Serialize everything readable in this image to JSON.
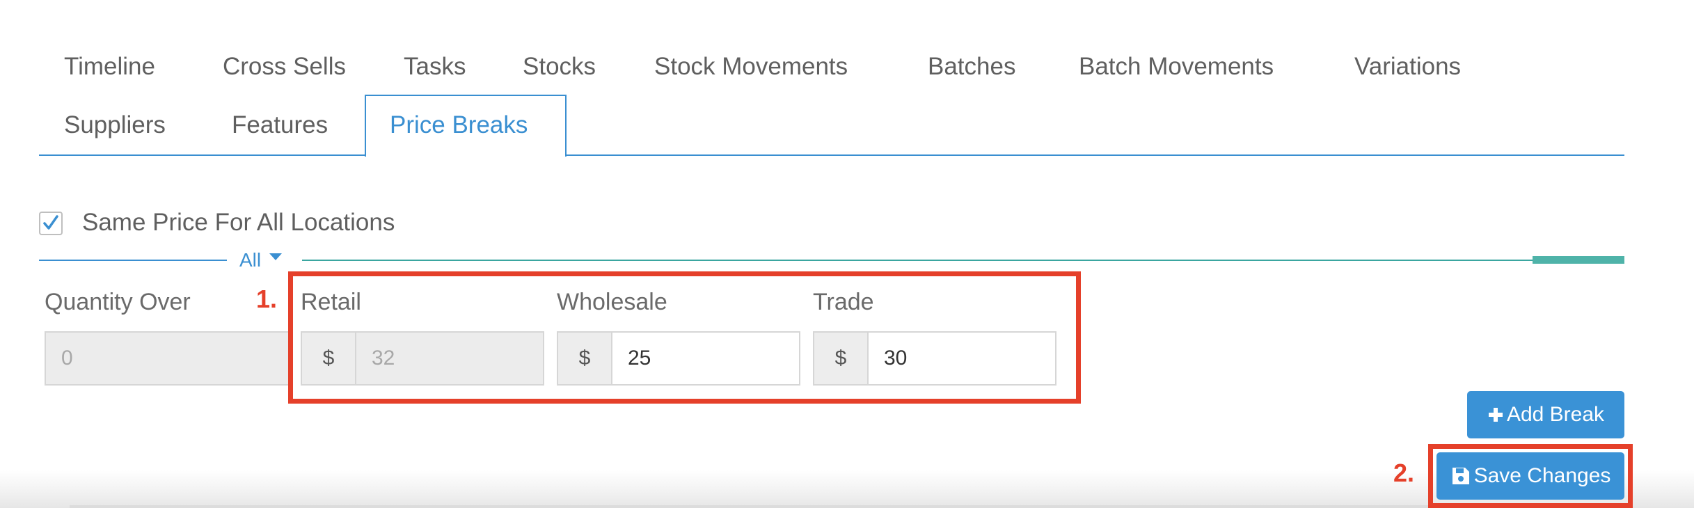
{
  "tabs": {
    "items": [
      {
        "label": "Timeline"
      },
      {
        "label": "Cross Sells"
      },
      {
        "label": "Tasks"
      },
      {
        "label": "Stocks"
      },
      {
        "label": "Stock Movements"
      },
      {
        "label": "Batches"
      },
      {
        "label": "Batch Movements"
      },
      {
        "label": "Variations"
      },
      {
        "label": "Suppliers"
      },
      {
        "label": "Features"
      },
      {
        "label": "Price Breaks"
      }
    ],
    "active": "Price Breaks"
  },
  "same_price": {
    "label": "Same Price For All Locations",
    "checked": true
  },
  "location": {
    "selected": "All",
    "icon": "caret-down-icon"
  },
  "price_break": {
    "quantity_over": {
      "label": "Quantity Over",
      "value": "0"
    },
    "retail": {
      "label": "Retail",
      "currency": "$",
      "value": "32"
    },
    "wholesale": {
      "label": "Wholesale",
      "currency": "$",
      "value": "25"
    },
    "trade": {
      "label": "Trade",
      "currency": "$",
      "value": "30"
    }
  },
  "buttons": {
    "add_break": {
      "label": "Add Break",
      "icon": "plus-icon"
    },
    "save_changes": {
      "label": "Save Changes",
      "icon": "save-icon"
    }
  },
  "annotations": {
    "first": "1.",
    "second": "2."
  },
  "colors": {
    "accent": "#3a8fd1",
    "button": "#3a92d6",
    "annotation": "#e5402a",
    "teal": "#4fb3a9"
  }
}
